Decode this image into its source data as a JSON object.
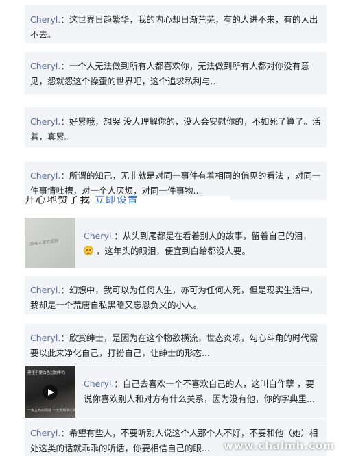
{
  "posts": [
    {
      "author": "Cheryl.",
      "sep": "：",
      "text": "这世界日趋繁华，我的内心却日渐荒芜，有的人进不来，有的人出不去。"
    },
    {
      "author": "Cheryl.",
      "sep": "：",
      "text": "一个人无法做到所有人都喜欢你，无法做到所有人都对你没有意见，怨就怨这个操蛋的世界吧，这个追求私利与..."
    },
    {
      "author": "Cheryl.",
      "sep": "：",
      "text": "好累哦，想哭 没人理解你的，没人会安慰你的，不如死了算了。活着，真累。"
    },
    {
      "author": "Cheryl.",
      "sep": "：",
      "text": "所谓的知己，无非就是对同一事件有着相同的偏见的看法 ，对同一件事情吐槽，对一个人厌烦，对同一件事物..."
    },
    {
      "author": "Cheryl.",
      "sep": "：",
      "text_a": "从头到尾都是在看着别人的故事，留着自己的泪，",
      "text_b": "，这年头的眼泪，便宜到白给都没人要。"
    },
    {
      "author": "Cheryl.",
      "sep": "：",
      "text": "幻想中，我可以为任何人生，亦可为任何人死，但是现实生活中，我却是一个荒唐自私黑暗又忘恩负义的小人。"
    },
    {
      "author": "Cheryl.",
      "sep": "：",
      "text": "欣赏绅士，是因为在这个物欲横流，世态炎凉，勾心斗角的时代需要以此来净化自己，打扮自己，让绅士的形态..."
    },
    {
      "author": "Cheryl.",
      "sep": "：",
      "text": "自己去喜欢一个不喜欢自己的人，这叫自作孽 ，要说你喜欢别人和对方有什么关系，因为没有他，你的字典里..."
    },
    {
      "author": "Cheryl.",
      "sep": "：",
      "text": "希望有些人，不要听别人说这个人那个人不好，不要和他（她）相处这类的话就乖乖的听话，你要相信自己的眼..."
    }
  ],
  "overlap_text": {
    "black": "开心地赞了我 ",
    "blue": "立即设置"
  },
  "thumbnails": {
    "book_scribble": "原来人喜欢孤独",
    "video_title": "典生不要白色过的牛吗",
    "video_sub": "一条主角的情感\n一无奈所的心动..."
  },
  "emoji_icon": "smiling-face-icon",
  "watermark": "www.chalmh.com"
}
